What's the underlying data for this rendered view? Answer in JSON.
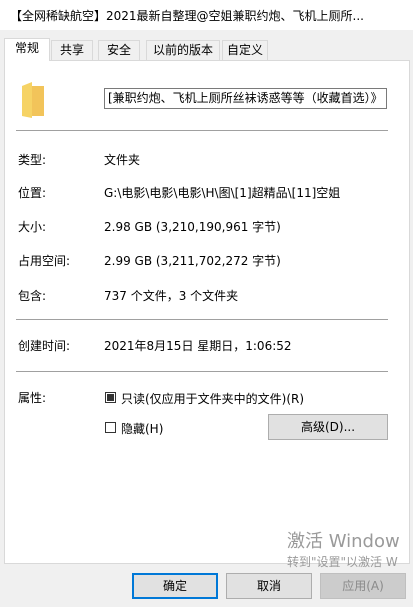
{
  "window": {
    "title": "【全网稀缺航空】2021最新自整理@空姐兼职约炮、飞机上厕所..."
  },
  "tabs": [
    {
      "label": "常规"
    },
    {
      "label": "共享"
    },
    {
      "label": "安全"
    },
    {
      "label": "以前的版本"
    },
    {
      "label": "自定义"
    }
  ],
  "general": {
    "name": "[兼职约炮、飞机上厕所丝袜诱惑等等（收藏首选）》",
    "type_label": "类型:",
    "type_value": "文件夹",
    "location_label": "位置:",
    "location_value": "G:\\电影\\电影\\电影\\H\\图\\[1]超精品\\[11]空姐",
    "size_label": "大小:",
    "size_value": "2.98 GB (3,210,190,961 字节)",
    "disk_size_label": "占用空间:",
    "disk_size_value": "2.99 GB (3,211,702,272 字节)",
    "contains_label": "包含:",
    "contains_value": "737 个文件，3 个文件夹",
    "created_label": "创建时间:",
    "created_value": "2021年8月15日 星期日，1:06:52",
    "attributes_label": "属性:",
    "readonly_label": "只读(仅应用于文件夹中的文件)(R)",
    "readonly_checked": true,
    "hidden_label": "隐藏(H)",
    "hidden_checked": false,
    "advanced_label": "高级(D)..."
  },
  "buttons": {
    "ok": "确定",
    "cancel": "取消",
    "apply": "应用(A)"
  },
  "watermark": {
    "line1": "激活 Window",
    "line2": "转到\"设置\"以激活 W"
  }
}
